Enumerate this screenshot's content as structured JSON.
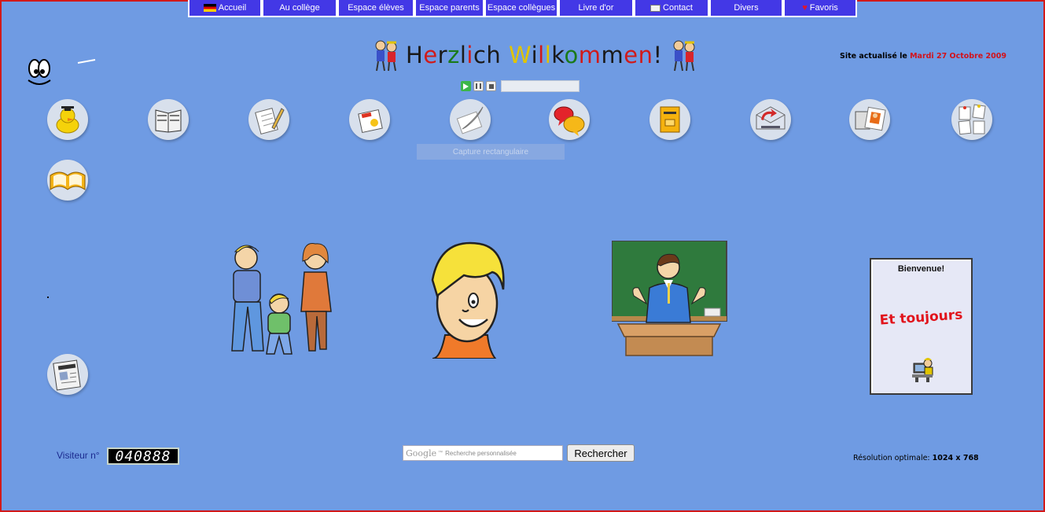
{
  "nav": {
    "items": [
      {
        "label": "Accueil",
        "icon": "german-flag-icon"
      },
      {
        "label": "Au collège"
      },
      {
        "label": "Espace élèves"
      },
      {
        "label": "Espace parents"
      },
      {
        "label": "Espace collègues"
      },
      {
        "label": "Livre d'or"
      },
      {
        "label": "Contact",
        "icon": "envelope-icon"
      },
      {
        "label": "Divers"
      },
      {
        "label": "Favoris",
        "icon": "heart-icon"
      }
    ]
  },
  "header": {
    "title_parts": [
      "H",
      "e",
      "r",
      "z",
      "l",
      "i",
      "c",
      "h",
      " ",
      "W",
      "i",
      "l",
      "l",
      "k",
      "o",
      "m",
      "m",
      "e",
      "n",
      "!"
    ],
    "title_colors": [
      "#1a1a1a",
      "#d01a1a",
      "#1a1a1a",
      "#1a7a1a",
      "#1a1a1a",
      "#d01a1a",
      "#1a1a1a",
      "#1a1a1a",
      "#1a1a1a",
      "#e0c400",
      "#1a1a1a",
      "#d01a1a",
      "#e0c400",
      "#1a1a1a",
      "#1a7a1a",
      "#d01a1a",
      "#1a1a1a",
      "#d01a1a",
      "#d01a1a",
      "#1a1a1a"
    ],
    "updated_prefix": "Site actualisé le ",
    "updated_date": "Mardi 27 Octobre 2009"
  },
  "capture_label": "Capture rectangulaire",
  "icons": [
    "duck-graduate-icon",
    "book-icon",
    "notepad-pencil-icon",
    "news-icon",
    "quill-icon",
    "speech-bubbles-icon",
    "mailbox-icon",
    "send-email-icon",
    "photo-frame-icon",
    "notes-board-icon",
    "open-book-icon",
    "journal-icon"
  ],
  "counter": {
    "label": "Visiteur n°",
    "value": "040888"
  },
  "search": {
    "brand": "Google",
    "tm": "™",
    "placeholder": "Recherche personnalisée",
    "button": "Rechercher"
  },
  "resolution": {
    "label": "Résolution optimale: ",
    "value": "1024 x 768"
  },
  "welcome": {
    "title": "Bienvenue!",
    "scroll_text": "Et toujours"
  },
  "colors": {
    "background": "#6f9be3",
    "nav": "#4338e6",
    "border": "#d21a1a",
    "date": "#d2121a"
  }
}
